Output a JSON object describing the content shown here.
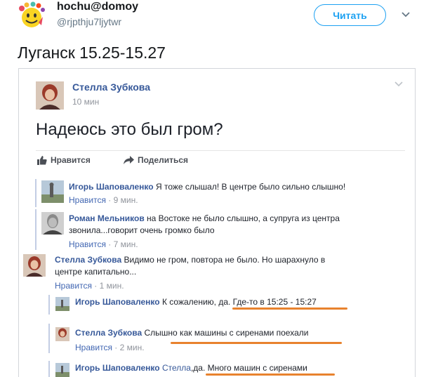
{
  "tweet": {
    "display_name": "hochu@domoy",
    "handle": "@rjpthju7ljytwr",
    "follow_label": "Читать",
    "text": "Луганск 15.25-15.27"
  },
  "post": {
    "author": "Стелла Зубкова",
    "time": "10 мин",
    "text": "Надеюсь это был гром?",
    "like_label": "Нравится",
    "share_label": "Поделиться"
  },
  "comments": [
    {
      "author": "Игорь Шаповаленко",
      "text": "Я тоже слышал! В центре было сильно слышно!",
      "like": "Нравится",
      "meta": " · 9 мин."
    },
    {
      "author": "Роман Мельников",
      "text_line1": "на Востоке не было слышно, а супруга из центра",
      "text_line2": "звонила...говорит очень громко было",
      "like": "Нравится",
      "meta": " · 7 мин."
    },
    {
      "author": "Стелла Зубкова",
      "text_line1": "Видимо не гром, повтора не было. Но шарахнуло в",
      "text_line2": "центре капитально...",
      "like": "Нравится",
      "meta": " · 1 мин."
    },
    {
      "author": "Игорь Шаповаленко",
      "text": "К сожалению, да. Где-то в 15:25 - 15:27"
    },
    {
      "author": "Стелла Зубкова",
      "text": "Слышно как машины с сиренами поехали",
      "like": "Нравится",
      "meta": " · 2 мин."
    },
    {
      "author": "Игорь Шаповаленко",
      "mention": "Стелла",
      "text": ",да. Много машин с сиренами"
    }
  ],
  "colors": {
    "twitter_blue": "#1da1f2",
    "fb_link": "#365899",
    "annotation": "#e8822e"
  },
  "icons": [
    "emoji-avatar-icon",
    "chevron-down-icon",
    "thumbs-up-icon",
    "share-arrow-icon"
  ]
}
